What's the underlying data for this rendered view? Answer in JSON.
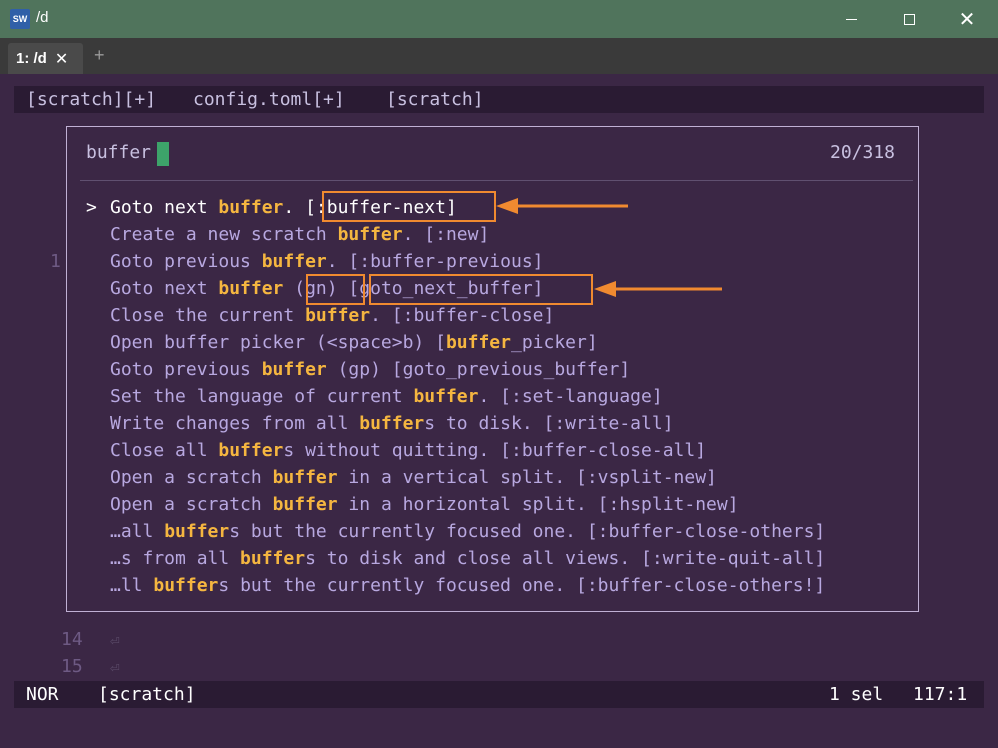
{
  "window": {
    "icon_text": "SW",
    "title": "/d",
    "close_glyph": "✕"
  },
  "terminal_tabs": {
    "active_tab": "1: /d",
    "close_glyph": "✕",
    "new_tab_glyph": "+"
  },
  "bufferline": {
    "buffers": [
      "[scratch][+]",
      "config.toml[+]",
      "[scratch]"
    ]
  },
  "gutter": {
    "line_1": "1",
    "line_14": "14",
    "line_15": "15",
    "eol_glyph": "⏎"
  },
  "picker": {
    "query": "buffer",
    "count": "20/318",
    "pointer": ">",
    "items": [
      [
        {
          "t": "Goto next "
        },
        {
          "t": "buffer",
          "h": true
        },
        {
          "t": ". [:buffer-next]"
        }
      ],
      [
        {
          "t": "Create a new scratch "
        },
        {
          "t": "buffer",
          "h": true
        },
        {
          "t": ". [:new]"
        }
      ],
      [
        {
          "t": "Goto previous "
        },
        {
          "t": "buffer",
          "h": true
        },
        {
          "t": ". [:buffer-previous]"
        }
      ],
      [
        {
          "t": "Goto next "
        },
        {
          "t": "buffer",
          "h": true
        },
        {
          "t": " (gn) [goto_next_buffer]"
        }
      ],
      [
        {
          "t": "Close the current "
        },
        {
          "t": "buffer",
          "h": true
        },
        {
          "t": ". [:buffer-close]"
        }
      ],
      [
        {
          "t": "Open buffer picker (<space>b) ["
        },
        {
          "t": "buffer",
          "h": true
        },
        {
          "t": "_picker]"
        }
      ],
      [
        {
          "t": "Goto previous "
        },
        {
          "t": "buffer",
          "h": true
        },
        {
          "t": " (gp) [goto_previous_buffer]"
        }
      ],
      [
        {
          "t": "Set the language of current "
        },
        {
          "t": "buffer",
          "h": true
        },
        {
          "t": ". [:set-language]"
        }
      ],
      [
        {
          "t": "Write changes from all "
        },
        {
          "t": "buffer",
          "h": true
        },
        {
          "t": "s to disk. [:write-all]"
        }
      ],
      [
        {
          "t": "Close all "
        },
        {
          "t": "buffer",
          "h": true
        },
        {
          "t": "s without quitting. [:buffer-close-all]"
        }
      ],
      [
        {
          "t": "Open a scratch "
        },
        {
          "t": "buffer",
          "h": true
        },
        {
          "t": " in a vertical split. [:vsplit-new]"
        }
      ],
      [
        {
          "t": "Open a scratch "
        },
        {
          "t": "buffer",
          "h": true
        },
        {
          "t": " in a horizontal split. [:hsplit-new]"
        }
      ],
      [
        {
          "t": "…all "
        },
        {
          "t": "buffer",
          "h": true
        },
        {
          "t": "s but the currently focused one. [:buffer-close-others]"
        }
      ],
      [
        {
          "t": "…s from all "
        },
        {
          "t": "buffer",
          "h": true
        },
        {
          "t": "s to disk and close all views. [:write-quit-all]"
        }
      ],
      [
        {
          "t": "…ll "
        },
        {
          "t": "buffer",
          "h": true
        },
        {
          "t": "s but the currently focused one. [:buffer-close-others!]"
        }
      ]
    ]
  },
  "statusline": {
    "mode": "NOR",
    "buffer_name": "[scratch]",
    "selections": "1 sel",
    "position": "117:1"
  },
  "colors": {
    "background": "#3b2745",
    "highlight": "#f5b640",
    "annotation": "#f08a30",
    "cursor": "#3da36a"
  }
}
